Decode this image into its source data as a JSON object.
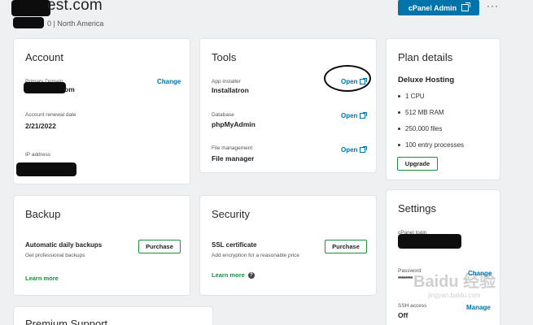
{
  "header": {
    "site_title": "est.com",
    "site_subtitle": "0 | North America",
    "cpanel_button": "cPanel Admin",
    "more_menu": "···"
  },
  "account": {
    "title": "Account",
    "primary_domain_label": "Primary Domain",
    "primary_domain_value": "om",
    "change_link": "Change",
    "renewal_label": "Account renewal date",
    "renewal_value": "2/21/2022",
    "ip_label": "IP address"
  },
  "tools": {
    "title": "Tools",
    "items": [
      {
        "label": "App installer",
        "value": "Installatron",
        "action": "Open"
      },
      {
        "label": "Database",
        "value": "phpMyAdmin",
        "action": "Open"
      },
      {
        "label": "File management",
        "value": "File manager",
        "action": "Open"
      }
    ]
  },
  "plan": {
    "title": "Plan details",
    "name": "Deluxe Hosting",
    "features": [
      "1 CPU",
      "512 MB RAM",
      "250,000 files",
      "100 entry processes"
    ],
    "upgrade_button": "Upgrade"
  },
  "backup": {
    "title": "Backup",
    "heading": "Automatic daily backups",
    "description": "Get professional backups",
    "purchase_button": "Purchase",
    "learn_more": "Learn more"
  },
  "security": {
    "title": "Security",
    "heading": "SSL certificate",
    "description": "Add encryption for a reasonable price",
    "purchase_button": "Purchase",
    "learn_more": "Learn more",
    "help_icon": "?"
  },
  "settings": {
    "title": "Settings",
    "cpanel_login_label": "cPanel login",
    "password_label": "Password",
    "password_value": "********",
    "password_change": "Change",
    "ssh_label": "SSH access",
    "ssh_value": "Off",
    "ssh_manage": "Manage"
  },
  "premium": {
    "title": "Premium Support"
  },
  "watermark": {
    "text": "Baidu 经验",
    "sub": "jingyan.baidu.com"
  }
}
